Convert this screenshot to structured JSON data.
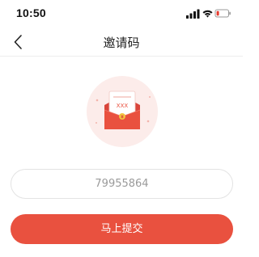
{
  "status_bar": {
    "time": "10:50",
    "icons": [
      "signal-icon",
      "wifi-icon",
      "battery-icon"
    ]
  },
  "nav": {
    "back_icon": "chevron-left-icon",
    "title": "邀请码"
  },
  "illustration": {
    "icon": "red-envelope-icon",
    "letter_text": "XXX",
    "colors": {
      "circle": "#fcecea",
      "envelope": "#e9513f",
      "seal": "#f4c542"
    }
  },
  "invite_code_input": {
    "value": "79955864"
  },
  "submit_button": {
    "label": "马上提交",
    "color": "#e9513f"
  }
}
